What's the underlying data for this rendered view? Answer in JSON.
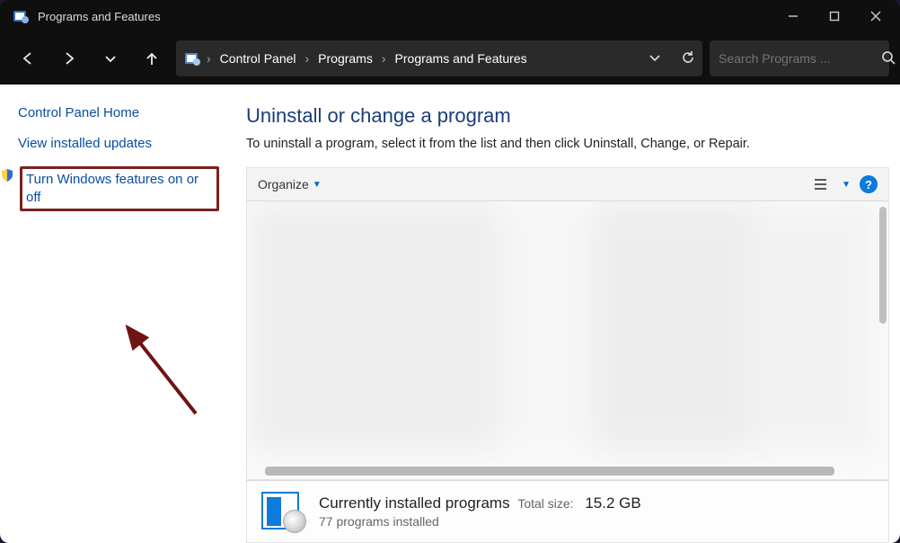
{
  "titlebar": {
    "title": "Programs and Features"
  },
  "breadcrumb": {
    "root": "Control Panel",
    "mid": "Programs",
    "leaf": "Programs and Features"
  },
  "search": {
    "placeholder": "Search Programs ..."
  },
  "sidebar": {
    "home": "Control Panel Home",
    "updates": "View installed updates",
    "features": "Turn Windows features on or off"
  },
  "main": {
    "heading": "Uninstall or change a program",
    "desc": "To uninstall a program, select it from the list and then click Uninstall, Change, or Repair."
  },
  "toolbar": {
    "organize": "Organize"
  },
  "footer": {
    "title": "Currently installed programs",
    "size_label": "Total size:",
    "size_value": "15.2 GB",
    "count": "77 programs installed"
  }
}
